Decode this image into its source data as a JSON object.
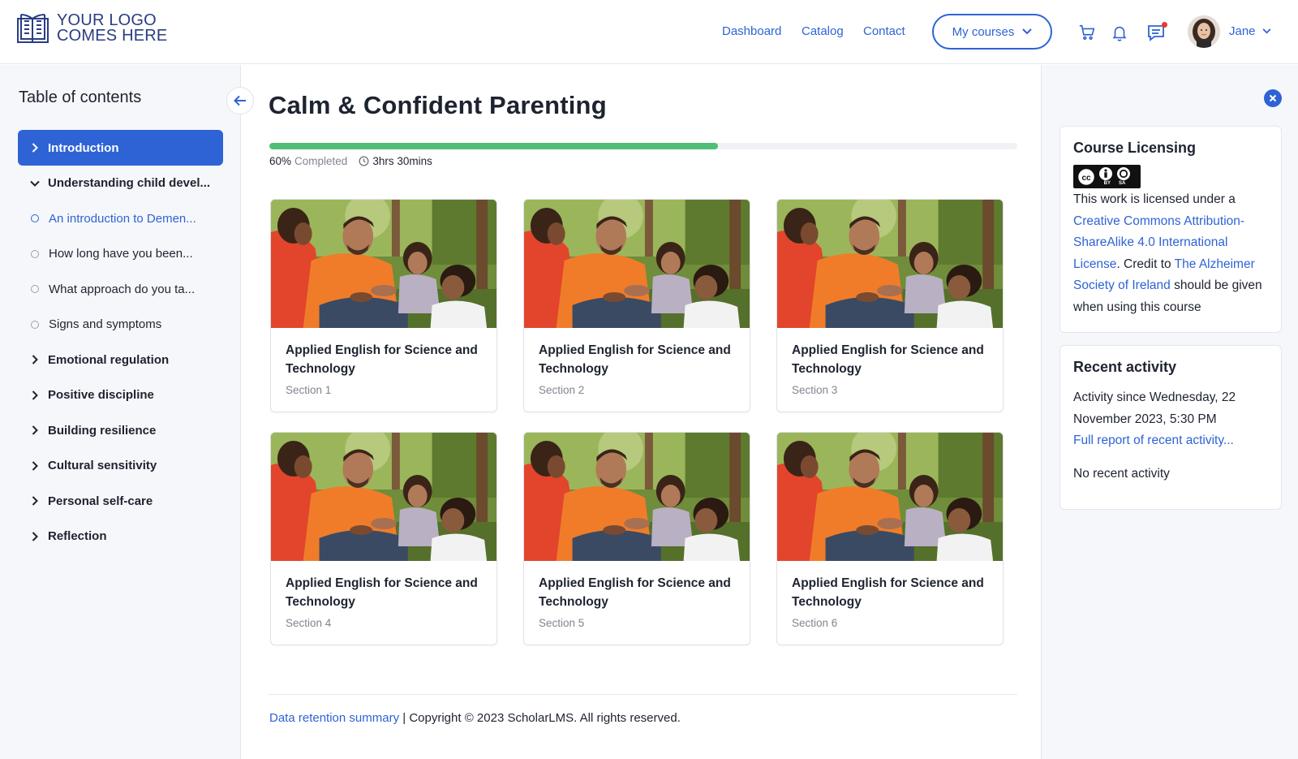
{
  "header": {
    "logo_line1": "YOUR LOGO",
    "logo_line2": "COMES HERE",
    "nav": [
      {
        "label": "Dashboard"
      },
      {
        "label": "Catalog"
      },
      {
        "label": "Contact"
      }
    ],
    "my_courses_label": "My courses",
    "user_name": "Jane"
  },
  "sidebar": {
    "title": "Table of contents",
    "items": [
      {
        "label": "Introduction"
      },
      {
        "label": "Understanding child devel..."
      },
      {
        "label": "An introduction to Demen..."
      },
      {
        "label": "How long have you been..."
      },
      {
        "label": "What approach do you ta..."
      },
      {
        "label": "Signs and symptoms"
      },
      {
        "label": "Emotional regulation"
      },
      {
        "label": "Positive discipline"
      },
      {
        "label": "Building resilience"
      },
      {
        "label": "Cultural sensitivity"
      },
      {
        "label": "Personal self-care"
      },
      {
        "label": "Reflection"
      }
    ]
  },
  "main": {
    "title": "Calm & Confident Parenting",
    "progress_fraction": 0.6,
    "progress_pct": "60%",
    "progress_completed": "Completed",
    "duration": "3hrs 30mins",
    "cards": [
      {
        "title": "Applied English for Science and Technology",
        "section": "Section 1"
      },
      {
        "title": "Applied English for Science and Technology",
        "section": "Section 2"
      },
      {
        "title": "Applied English for Science and Technology",
        "section": "Section 3"
      },
      {
        "title": "Applied English for Science and Technology",
        "section": "Section 4"
      },
      {
        "title": "Applied English for Science and Technology",
        "section": "Section 5"
      },
      {
        "title": "Applied English for Science and Technology",
        "section": "Section 6"
      }
    ],
    "footer_link": "Data retention summary",
    "footer_sep": "|",
    "footer_text": "Copyright © 2023 ScholarLMS. All rights reserved."
  },
  "right_panel": {
    "licensing_title": "Course Licensing",
    "licensing_text1": "This work is licensed under a",
    "licensing_link1": "Creative Commons Attribution-ShareAlike 4.0 International License",
    "licensing_text2": ". Credit to",
    "licensing_link2": "The Alzheimer Society of Ireland",
    "licensing_text3": "should be given when using this course",
    "cc_by": "BY",
    "cc_sa": "SA",
    "activity_title": "Recent activity",
    "activity_since": "Activity since Wednesday, 22 November 2023, 5:30 PM",
    "activity_link": "Full report of recent activity...",
    "activity_none": "No recent activity"
  },
  "colors": {
    "accent": "#2e63d6",
    "progress": "#4fbf77",
    "logo": "#2a3d82",
    "notification": "#e53935"
  }
}
